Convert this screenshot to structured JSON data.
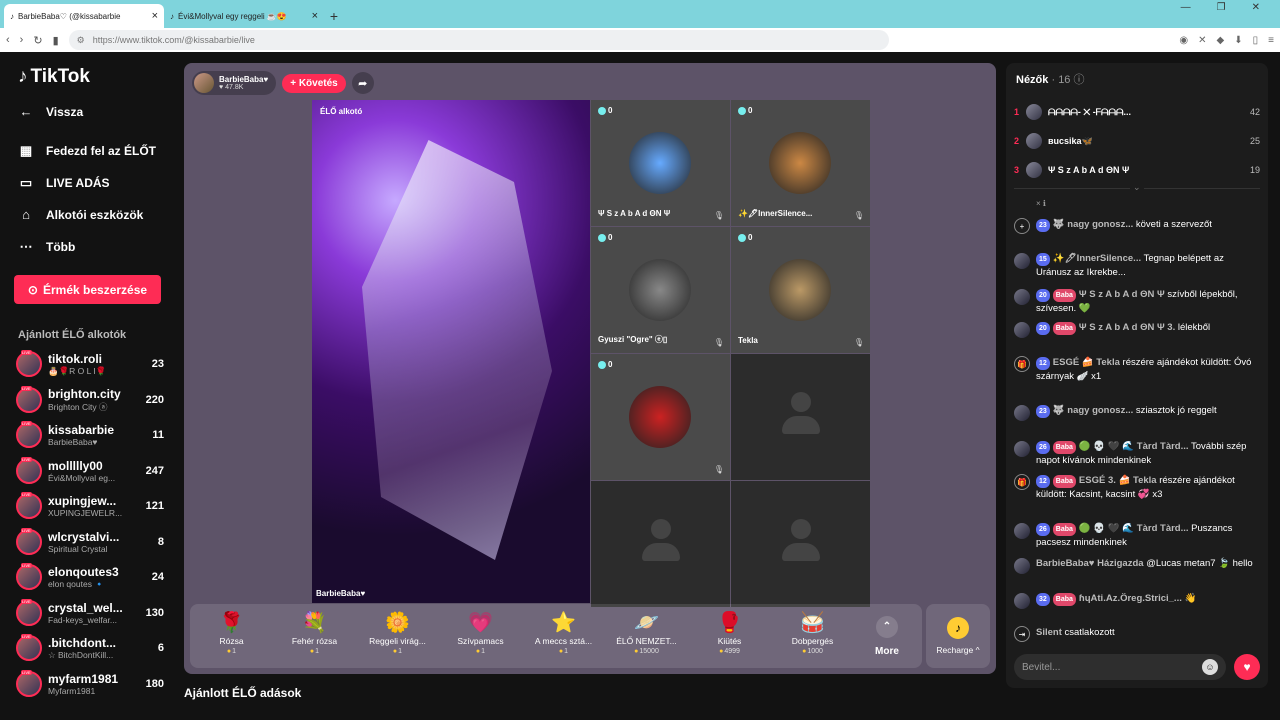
{
  "browser": {
    "tabs": [
      {
        "title": "BarbieBaba♡ (@kissabarbie",
        "active": true
      },
      {
        "title": "Évi&Mollyval egy reggeli ☕😍",
        "active": false
      }
    ],
    "url": "https://www.tiktok.com/@kissabarbie/live"
  },
  "sidebar": {
    "logo": "TikTok",
    "back": "Vissza",
    "nav": [
      {
        "label": "Fedezd fel az ÉLŐT",
        "icon": "calendar-icon"
      },
      {
        "label": "LIVE ADÁS",
        "icon": "video-icon"
      },
      {
        "label": "Alkotói eszközök",
        "icon": "house-icon"
      },
      {
        "label": "Több",
        "icon": "more-icon"
      }
    ],
    "coins_button": "Érmék beszerzése",
    "recommended_title": "Ajánlott ÉLŐ alkotók",
    "creators": [
      {
        "name": "tiktok.roli",
        "sub": "🎂🌹R O L I🌹",
        "count": "23"
      },
      {
        "name": "brighton.city",
        "sub": "Brighton City ⓐ",
        "count": "220"
      },
      {
        "name": "kissabarbie",
        "sub": "BarbieBaba♥",
        "count": "11"
      },
      {
        "name": "mollllly00",
        "sub": "Évi&Mollyval eg...",
        "count": "247"
      },
      {
        "name": "xupingjew...",
        "sub": "XUPINGJEWELR...",
        "count": "121"
      },
      {
        "name": "wlcrystalvi...",
        "sub": "Spiritual Crystal",
        "count": "8"
      },
      {
        "name": "elonqoutes3",
        "sub": "elon qoutes 🔹",
        "count": "24"
      },
      {
        "name": "crystal_wel...",
        "sub": "Fad-keys_welfar...",
        "count": "130"
      },
      {
        "name": ".bitchdont...",
        "sub": "☆ BitchDontKill...",
        "count": "6"
      },
      {
        "name": "myfarm1981",
        "sub": "Myfarm1981",
        "count": "180"
      }
    ]
  },
  "stage": {
    "host_name": "BarbieBaba♥",
    "host_likes": "♥ 47.8K",
    "follow": "+ Követés",
    "main_label": "ÉLŐ alkotó",
    "main_footer": "BarbieBaba♥",
    "guests": [
      {
        "name": "Ψ S z A b A d ΘN Ψ",
        "count": "0",
        "empty": false,
        "color": "#6af"
      },
      {
        "name": "✨🖊InnerSilence...",
        "count": "0",
        "empty": false,
        "color": "#c84"
      },
      {
        "name": "Gyuszi \"Ogre\" ⓔ▯",
        "count": "0",
        "empty": false,
        "color": "#888"
      },
      {
        "name": "Tekla",
        "count": "0",
        "empty": false,
        "color": "#b96"
      },
      {
        "name": "",
        "count": "0",
        "empty": false,
        "color": "#c22"
      },
      {
        "name": "",
        "count": "",
        "empty": true,
        "color": ""
      },
      {
        "name": "",
        "count": "",
        "empty": true,
        "color": ""
      },
      {
        "name": "",
        "count": "",
        "empty": true,
        "color": ""
      }
    ],
    "gifts": [
      {
        "name": "Rózsa",
        "price": "1",
        "icon": "🌹"
      },
      {
        "name": "Fehér rózsa",
        "price": "1",
        "icon": "💐"
      },
      {
        "name": "Reggeli virág...",
        "price": "1",
        "icon": "🌼"
      },
      {
        "name": "Szívpamacs",
        "price": "1",
        "icon": "💗"
      },
      {
        "name": "A meccs sztá...",
        "price": "1",
        "icon": "⭐"
      },
      {
        "name": "ÉLŐ NEMZET...",
        "price": "15000",
        "icon": "🪐"
      },
      {
        "name": "Kiütés",
        "price": "4999",
        "icon": "🥊"
      },
      {
        "name": "Dobpergés",
        "price": "1000",
        "icon": "🥁"
      }
    ],
    "more": "More",
    "recharge": "Recharge ^"
  },
  "below_title": "Ajánlott ÉLŐ adások",
  "viewers": {
    "title": "Nézők",
    "count": "· 16",
    "top": [
      {
        "rank": "1",
        "name": "ᗩᗩᗩᗩ- ✕ -ᖴᗩᗩᗩ...",
        "score": "42"
      },
      {
        "rank": "2",
        "name": "вucsika🦋",
        "score": "25"
      },
      {
        "rank": "3",
        "name": "Ψ S z A b A d ΘN Ψ",
        "score": "19"
      }
    ]
  },
  "chat": {
    "small": "× ℹ",
    "messages": [
      {
        "lv": "23",
        "fan": "",
        "who": "🐺 nagy gonosz...",
        "text": "követi a szervezőt",
        "sys": "user-plus-icon"
      },
      {
        "lv": "15",
        "fan": "",
        "who": "✨🖊InnerSilence...",
        "text": "Tegnap belépett az Uránusz az Ikrekbe...",
        "sys": ""
      },
      {
        "lv": "20",
        "fan": "Baba",
        "who": "Ψ S z A b A d ΘN Ψ",
        "text": "szívből lépekből, szívesen. 💚",
        "sys": ""
      },
      {
        "lv": "20",
        "fan": "Baba",
        "who": "Ψ S z A b A d ΘN Ψ 3.",
        "text": "lélekből",
        "sys": ""
      },
      {
        "lv": "12",
        "fan": "",
        "who": "ESGÉ 🍰 Tekla",
        "text": "részére ajándékot küldött: Óvó szárnyak 🪽 x1",
        "sys": "gift-icon"
      },
      {
        "lv": "23",
        "fan": "",
        "who": "🐺 nagy gonosz...",
        "text": "sziasztok jó reggelt",
        "sys": ""
      },
      {
        "lv": "26",
        "fan": "Baba",
        "who": "🟢 💀 🖤 🌊 Tàrd Tàrd...",
        "text": "További szép napot kívánok mindenkinek",
        "sys": ""
      },
      {
        "lv": "12",
        "fan": "Baba",
        "who": "ESGÉ 3. 🍰 Tekla",
        "text": "részére ajándékot küldött: Kacsint, kacsint 💞 x3",
        "sys": "gift-icon"
      },
      {
        "lv": "26",
        "fan": "Baba",
        "who": "🟢 💀 🖤 🌊 Tàrd Tàrd...",
        "text": "Puszancs pacsesz mindenkinek",
        "sys": ""
      },
      {
        "lv": "",
        "fan": "",
        "who": "BarbieBaba♥ Házigazda",
        "text": "@Lucas metan7 🍃 hello",
        "sys": ""
      },
      {
        "lv": "32",
        "fan": "Baba",
        "who": "ɦɥAti.Az.Öreg.Strici_...",
        "text": "👋",
        "sys": ""
      },
      {
        "lv": "",
        "fan": "",
        "who": "Silent",
        "text": "csatlakozott",
        "sys": "join-icon"
      }
    ],
    "input_placeholder": "Bevitel..."
  }
}
